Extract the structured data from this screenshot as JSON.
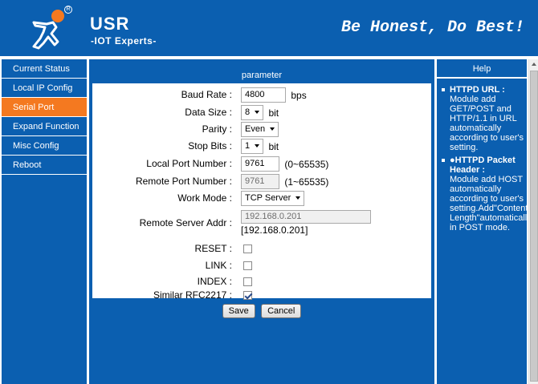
{
  "header": {
    "brand": "USR",
    "tagline": "-IOT Experts-",
    "slogan": "Be Honest, Do Best!",
    "registered_mark": "R"
  },
  "nav": {
    "items": [
      {
        "label": "Current Status",
        "active": false
      },
      {
        "label": "Local IP Config",
        "active": false
      },
      {
        "label": "Serial Port",
        "active": true
      },
      {
        "label": "Expand Function",
        "active": false
      },
      {
        "label": "Misc Config",
        "active": false
      },
      {
        "label": "Reboot",
        "active": false
      }
    ]
  },
  "panel": {
    "title": "parameter",
    "baud_rate": {
      "label": "Baud Rate :",
      "value": "4800",
      "unit": "bps"
    },
    "data_size": {
      "label": "Data Size :",
      "value": "8",
      "unit": "bit"
    },
    "parity": {
      "label": "Parity :",
      "value": "Even"
    },
    "stop_bits": {
      "label": "Stop Bits :",
      "value": "1",
      "unit": "bit"
    },
    "local_port": {
      "label": "Local Port Number :",
      "value": "9761",
      "range": "(0~65535)"
    },
    "remote_port": {
      "label": "Remote Port Number :",
      "value": "9761",
      "range": "(1~65535)"
    },
    "work_mode": {
      "label": "Work Mode :",
      "value": "TCP Server"
    },
    "remote_addr": {
      "label": "Remote Server Addr :",
      "value": "192.168.0.201",
      "display": "[192.168.0.201]"
    },
    "reset": {
      "label": "RESET :",
      "checked": false
    },
    "link": {
      "label": "LINK :",
      "checked": false
    },
    "index": {
      "label": "INDEX :",
      "checked": false
    },
    "rfc2217": {
      "label": "Similar RFC2217 :",
      "checked": true
    }
  },
  "actions": {
    "save": "Save",
    "cancel": "Cancel"
  },
  "help": {
    "title": "Help",
    "item1_title": "HTTPD URL :",
    "item1_body": "Module add GET/POST and HTTP/1.1 in URL automatically according to user's setting.",
    "item2_title": "●HTTPD Packet Header :",
    "item2_body": "Module add HOST automatically according to user's setting.Add\"Content-Length\"automatically in POST mode."
  },
  "colors": {
    "brand_blue": "#0b5fb0",
    "active_orange": "#f47920",
    "logo_orange": "#f47920"
  }
}
